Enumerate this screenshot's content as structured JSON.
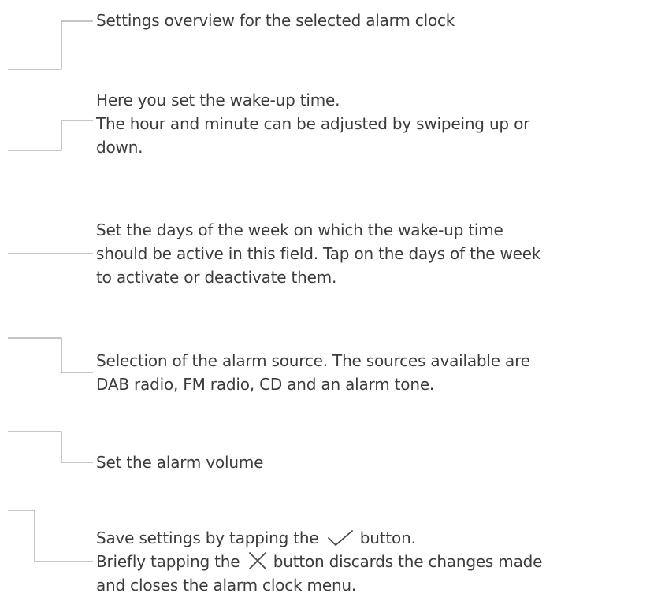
{
  "notes": [
    {
      "name": "settings-overview",
      "lines": [
        "Settings overview for the selected alarm clock"
      ]
    },
    {
      "name": "wake-up-time",
      "lines": [
        "Here you set the wake-up time.",
        "The hour and minute can be adjusted by swipeing up or",
        "down."
      ]
    },
    {
      "name": "days-of-week",
      "lines": [
        "Set the days of the week on which the wake-up time",
        "should be active in this field. Tap on the days of the week",
        "to activate or deactivate them."
      ]
    },
    {
      "name": "alarm-source",
      "lines": [
        "Selection of the alarm source. The sources available are",
        "DAB radio, FM radio, CD and an alarm tone."
      ]
    },
    {
      "name": "alarm-volume",
      "lines": [
        "Set the alarm volume"
      ]
    },
    {
      "name": "save-discard",
      "line1_before": "Save settings by tapping the",
      "line1_after": "button.",
      "line2_before": "Briefly tapping the",
      "line2_after": "button discards the changes made",
      "line3": "and closes the alarm clock menu.",
      "icons": [
        "checkmark-icon",
        "close-icon"
      ]
    }
  ]
}
